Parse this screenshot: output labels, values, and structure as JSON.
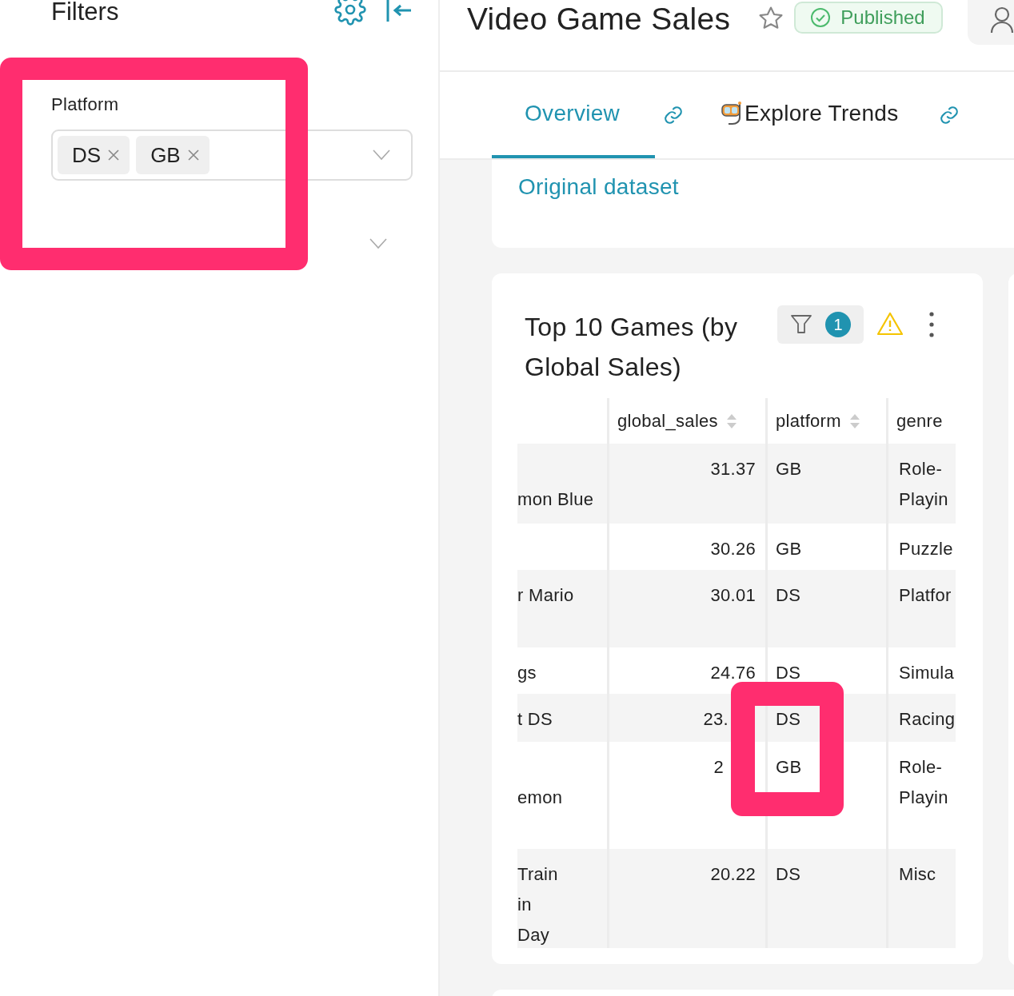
{
  "sidebar": {
    "title": "Filters",
    "filters": [
      {
        "label": "Platform",
        "values": [
          "DS",
          "GB"
        ]
      }
    ]
  },
  "header": {
    "title": "Video Game Sales",
    "starred": false,
    "status": "Published"
  },
  "tabs": [
    {
      "label": "Overview",
      "selected": true
    },
    {
      "label": "Explore Trends",
      "selected": false
    }
  ],
  "dataset_link": "Original dataset",
  "chart_card": {
    "title": "Top 10 Games (by Global Sales)",
    "filter_count": "1",
    "columns": [
      {
        "label": "global_sales",
        "sortable": true
      },
      {
        "label": "platform",
        "sortable": true
      },
      {
        "label": "genre",
        "sortable": false
      }
    ],
    "rows": [
      {
        "column_1": "mon Blue",
        "global_sales": "31.37",
        "platform": "GB",
        "genre": "Role-Playin"
      },
      {
        "column_1": "",
        "global_sales": "30.26",
        "platform": "GB",
        "genre": "Puzzle"
      },
      {
        "column_1": "r Mario",
        "global_sales": "30.01",
        "platform": "DS",
        "genre": "Platfor"
      },
      {
        "column_1": "gs",
        "global_sales": "24.76",
        "platform": "DS",
        "genre": "Simula"
      },
      {
        "column_1": "t DS",
        "global_sales": "23.",
        "platform": "DS",
        "genre": "Racing"
      },
      {
        "column_1": "emon",
        "global_sales": "2",
        "platform": "GB",
        "genre": "Role-Playin"
      },
      {
        "column_1": "Train\nin\nDay",
        "global_sales": "20.22",
        "platform": "DS",
        "genre": "Misc"
      }
    ]
  },
  "highlights": [
    {
      "kind": "frame"
    },
    {
      "kind": "frame"
    }
  ]
}
